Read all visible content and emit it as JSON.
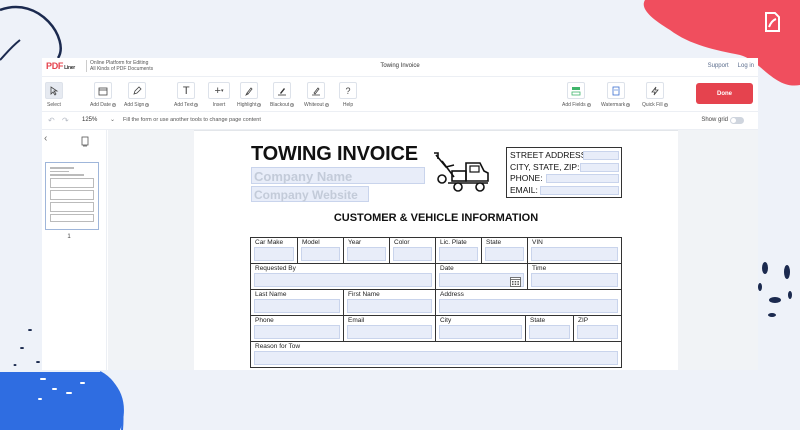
{
  "app": {
    "logo_text": "PDF",
    "logo_suffix": "Liner",
    "tagline_1": "Online Platform for Editing",
    "tagline_2": "All Kinds of PDF Documents",
    "document_title": "Towing Invoice",
    "links": {
      "support": "Support",
      "login": "Log in"
    },
    "brand_color": "#e5434e"
  },
  "toolbar": {
    "select": "Select",
    "add_date": "Add Date",
    "add_sign": "Add Sign",
    "add_text": "Add Text",
    "insert": "Insert",
    "highlight": "Highlight",
    "blackout": "Blackout",
    "whiteout": "Whiteout",
    "help": "Help",
    "add_fields": "Add Fields",
    "watermark": "Watermark",
    "quick_fill": "Quick Fill",
    "done": "Done"
  },
  "subbar": {
    "zoom": "125%",
    "hint": "Fill the form or use another tools to change page content",
    "show_grid": "Show grid"
  },
  "sidebar": {
    "page_number": "1"
  },
  "document": {
    "title": "TOWING INVOICE",
    "company_name_placeholder": "Company Name",
    "company_website_placeholder": "Company Website",
    "address_labels": [
      "STREET ADDRESS:",
      "CITY, STATE, ZIP:",
      "PHONE:",
      "EMAIL:"
    ],
    "section_title": "CUSTOMER & VEHICLE INFORMATION",
    "rows": [
      [
        "Car Make",
        "Model",
        "Year",
        "Color",
        "Lic. Plate",
        "State",
        "VIN"
      ],
      [
        "Requested By",
        "Date",
        "Time"
      ],
      [
        "Last Name",
        "First Name",
        "Address"
      ],
      [
        "Phone",
        "Email",
        "City",
        "State",
        "ZIP"
      ],
      [
        "Reason for Tow"
      ]
    ]
  }
}
